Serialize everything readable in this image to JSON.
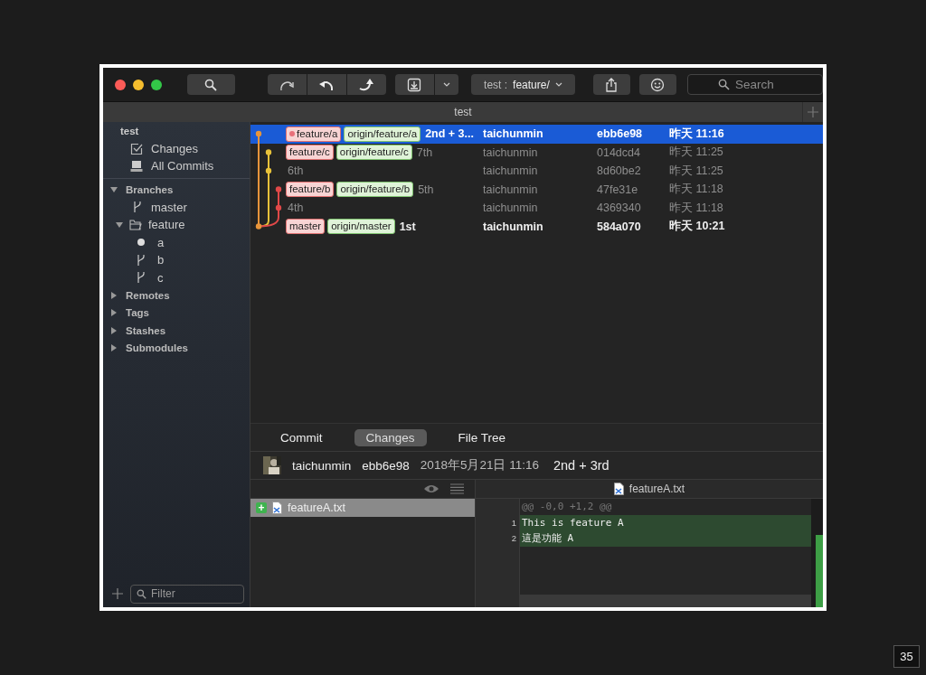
{
  "toolbar": {
    "branch_selector": {
      "repo": "test :",
      "branch": "feature/"
    },
    "search": {
      "placeholder": "Search"
    }
  },
  "tab_title": "test",
  "sidebar": {
    "repo": "test",
    "items": [
      {
        "label": "Changes",
        "selected": false
      },
      {
        "label": "All Commits",
        "selected": false
      }
    ],
    "sections": [
      {
        "label": "Branches",
        "expanded": true,
        "children": [
          {
            "label": "master",
            "kind": "branch",
            "current": false
          },
          {
            "label": "feature",
            "kind": "folder",
            "expanded": true,
            "children": [
              {
                "label": "a",
                "current": true
              },
              {
                "label": "b",
                "current": false
              },
              {
                "label": "c",
                "current": false
              }
            ]
          }
        ]
      },
      {
        "label": "Remotes",
        "expanded": false
      },
      {
        "label": "Tags",
        "expanded": false
      },
      {
        "label": "Stashes",
        "expanded": false
      },
      {
        "label": "Submodules",
        "expanded": false
      }
    ],
    "filter": {
      "placeholder": "Filter"
    }
  },
  "commits": [
    {
      "refs": [
        {
          "name": "feature/a",
          "kind": "local",
          "current": true
        },
        {
          "name": "origin/feature/a",
          "kind": "remote",
          "current": false
        }
      ],
      "message": "2nd + 3...",
      "author": "taichunmin",
      "hash": "ebb6e98",
      "date": "昨天 11:16",
      "selected": true,
      "dimmed": false
    },
    {
      "refs": [
        {
          "name": "feature/c",
          "kind": "local",
          "current": false
        },
        {
          "name": "origin/feature/c",
          "kind": "remote",
          "current": false
        }
      ],
      "message": "7th",
      "author": "taichunmin",
      "hash": "014dcd4",
      "date": "昨天 11:25",
      "selected": false,
      "dimmed": true
    },
    {
      "message": "6th",
      "author": "taichunmin",
      "hash": "8d60be2",
      "date": "昨天 11:25",
      "selected": false,
      "dimmed": true
    },
    {
      "refs": [
        {
          "name": "feature/b",
          "kind": "local",
          "current": false
        },
        {
          "name": "origin/feature/b",
          "kind": "remote",
          "current": false
        }
      ],
      "message": "5th",
      "author": "taichunmin",
      "hash": "47fe31e",
      "date": "昨天 11:18",
      "selected": false,
      "dimmed": true
    },
    {
      "message": "4th",
      "author": "taichunmin",
      "hash": "4369340",
      "date": "昨天 11:18",
      "selected": false,
      "dimmed": true
    },
    {
      "refs": [
        {
          "name": "master",
          "kind": "local",
          "current": false
        },
        {
          "name": "origin/master",
          "kind": "remote",
          "current": false
        }
      ],
      "message": "1st",
      "author": "taichunmin",
      "hash": "584a070",
      "date": "昨天 10:21",
      "selected": false,
      "dimmed": false
    }
  ],
  "detail_tabs": [
    {
      "label": "Commit",
      "selected": false
    },
    {
      "label": "Changes",
      "selected": true
    },
    {
      "label": "File Tree",
      "selected": false
    }
  ],
  "commit_info": {
    "author": "taichunmin",
    "hash": "ebb6e98",
    "date": "2018年5月21日 11:16",
    "message": "2nd + 3rd"
  },
  "files": [
    {
      "badge": "+",
      "name": "featureA.txt",
      "selected": true
    }
  ],
  "diff": {
    "file": "featureA.txt",
    "hunk": "@@ -0,0 +1,2 @@",
    "lines": [
      {
        "number": "1",
        "text": "This is feature A",
        "kind": "added"
      },
      {
        "number": "2",
        "text": "這是功能 A",
        "kind": "added"
      }
    ]
  },
  "page_number": "35"
}
